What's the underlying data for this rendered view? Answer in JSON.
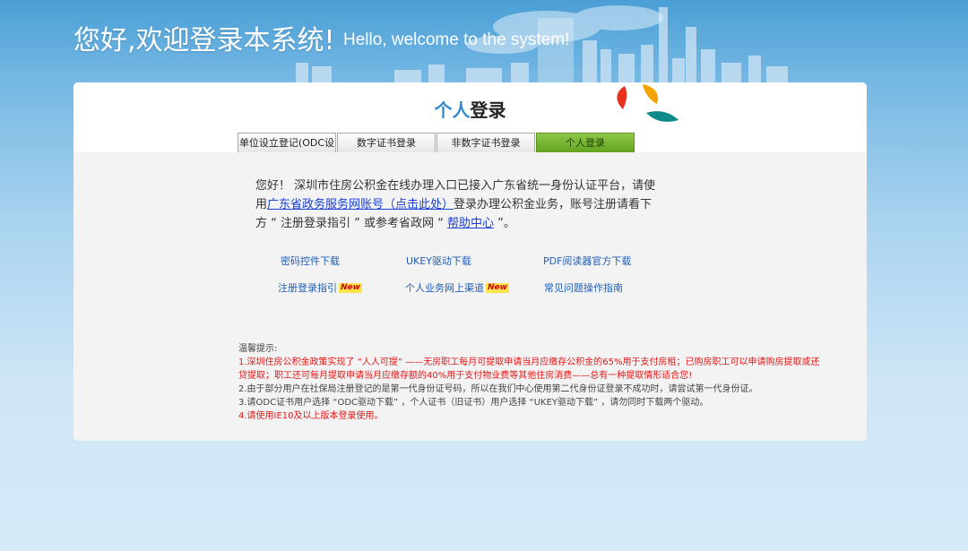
{
  "header": {
    "welcome_cn": "您好,欢迎登录本系统!",
    "welcome_en": "Hello, welcome to the system!"
  },
  "panel": {
    "title_highlight": "个人",
    "title_rest": "登录",
    "logo": "rainbow-petals-logo"
  },
  "tabs": [
    {
      "label": "单位设立登记(ODC设",
      "active": false
    },
    {
      "label": "数字证书登录",
      "active": false
    },
    {
      "label": "非数字证书登录",
      "active": false
    },
    {
      "label": "个人登录",
      "active": true
    }
  ],
  "intro": {
    "part1": "您好！ 深圳市住房公积金在线办理入口已接入广东省统一身份认证平台，请使用",
    "link1": "广东省政务服务网账号（点击此处）",
    "part2": "登录办理公积金业务，账号注册请看下方 “ 注册登录指引 ” 或参考省政网 “ ",
    "link2": "帮助中心",
    "part3": " ”。"
  },
  "links": {
    "row1": [
      "密码控件下载",
      "UKEY驱动下载",
      "PDF阅读器官方下载"
    ],
    "row2": [
      "注册登录指引",
      "个人业务网上渠道",
      "常见问题操作指南"
    ],
    "new_badge": "New"
  },
  "tips": {
    "heading": "温馨提示:",
    "line1": "1.深圳住房公积金政策实现了 “人人可提” ——无房职工每月可提取申请当月应缴存公积金的65%用于支付房租；已购房职工可以申请购房提取或还贷提取；职工还可每月提取申请当月应缴存额的40%用于支付物业费等其他住房消费——总有一种提取情形适合您!",
    "line2": "2.由于部分用户在社保局注册登记的是第一代身份证号码，所以在我们中心使用第二代身份证登录不成功时，请尝试第一代身份证。",
    "line3": "3.请ODC证书用户选择 “ODC驱动下载” ，个人证书（旧证书）用户选择 “UKEY驱动下载” ，请勿同时下载两个驱动。",
    "line4": "4.请使用IE10及以上版本登录使用。"
  },
  "colors": {
    "accent": "#2f8ad0",
    "active_tab": "#62a31f",
    "warning": "#e01818",
    "link": "#1f5eb8"
  }
}
